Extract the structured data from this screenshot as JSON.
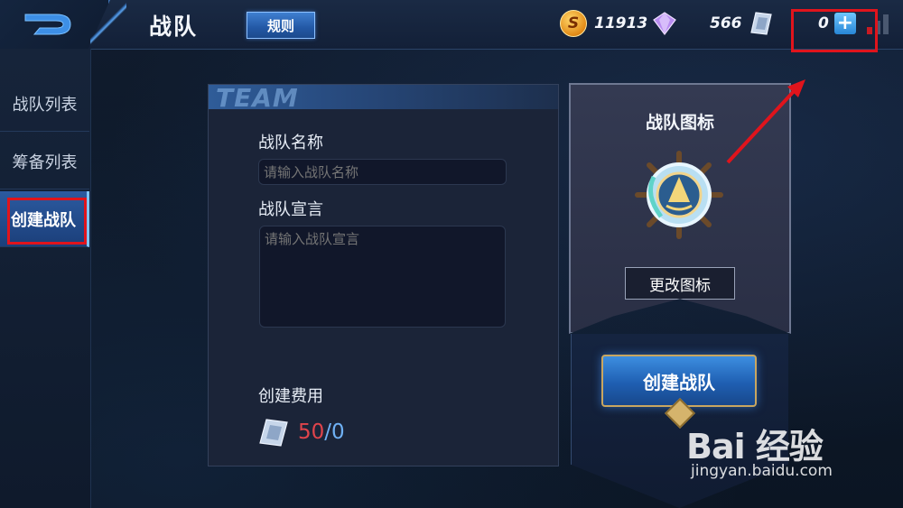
{
  "header": {
    "title": "战队",
    "rules_label": "规则",
    "coins": "11913",
    "diamonds": "566",
    "tickets": "0",
    "plus_label": "+"
  },
  "sidebar": {
    "items": [
      {
        "label": "战队列表"
      },
      {
        "label": "筹备列表"
      },
      {
        "label": "创建战队"
      }
    ]
  },
  "form": {
    "banner_text": "TEAM",
    "name_label": "战队名称",
    "name_placeholder": "请输入战队名称",
    "slogan_label": "战队宣言",
    "slogan_placeholder": "请输入战队宣言",
    "cost_label": "创建费用",
    "cost_current": "50",
    "cost_separator": "/",
    "cost_owned": "0"
  },
  "emblem_panel": {
    "title": "战队图标",
    "change_label": "更改图标",
    "create_label": "创建战队"
  },
  "watermark": {
    "logo": "Bai 经验",
    "url": "jingyan.baidu.com"
  },
  "colors": {
    "accent_blue": "#2358a5",
    "highlight_red": "#e0141c",
    "cost_red": "#e0444b",
    "cost_blue": "#6fb1f5"
  },
  "active_sidebar_index": 2
}
